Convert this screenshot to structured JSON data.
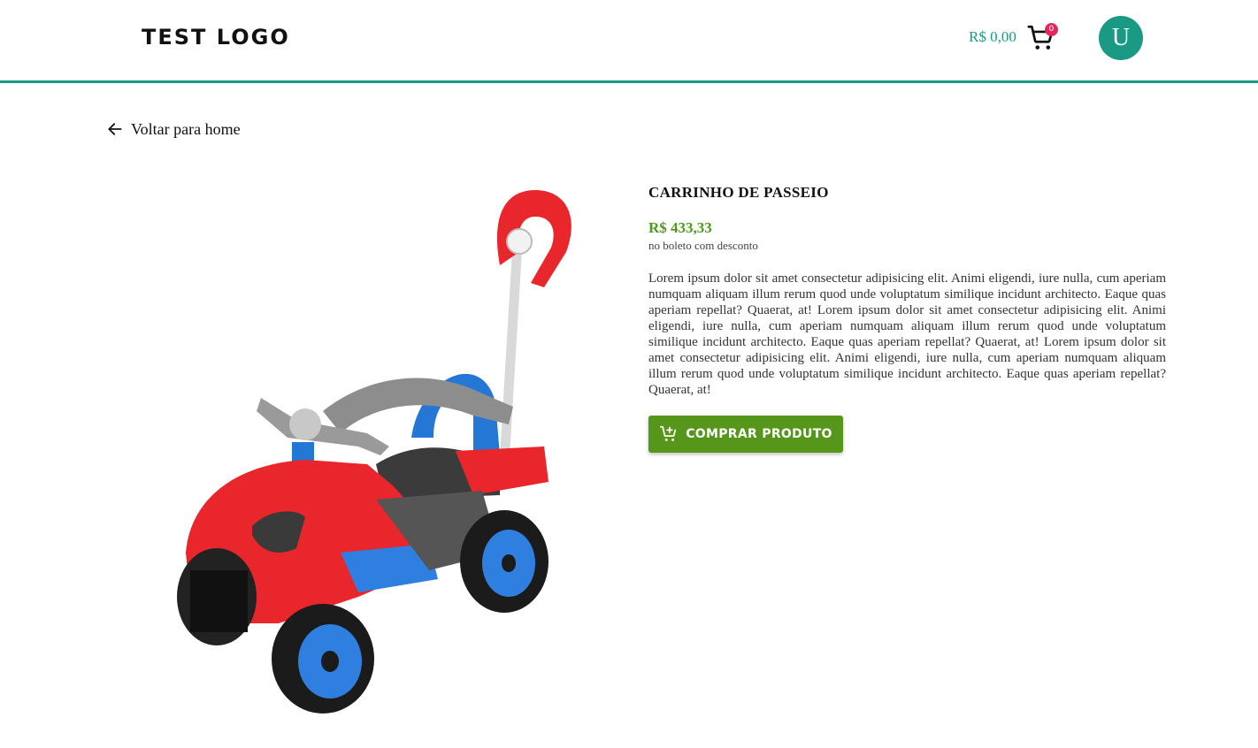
{
  "header": {
    "logo": "TEST LOGO",
    "cart_total": "R$ 0,00",
    "cart_count": "0",
    "avatar_initial": "U"
  },
  "nav": {
    "back_label": "Voltar para home"
  },
  "product": {
    "title": "CARRINHO DE PASSEIO",
    "price": "R$ 433,33",
    "price_note": "no boleto com desconto",
    "description": "Lorem ipsum dolor sit amet consectetur adipisicing elit. Animi eligendi, iure nulla, cum aperiam numquam aliquam illum rerum quod unde voluptatum similique incidunt architecto. Eaque quas aperiam repellat? Quaerat, at! Lorem ipsum dolor sit amet consectetur adipisicing elit. Animi eligendi, iure nulla, cum aperiam numquam aliquam illum rerum quod unde voluptatum similique incidunt architecto. Eaque quas aperiam repellat? Quaerat, at! Lorem ipsum dolor sit amet consectetur adipisicing elit. Animi eligendi, iure nulla, cum aperiam numquam aliquam illum rerum quod unde voluptatum similique incidunt architecto. Eaque quas aperiam repellat? Quaerat, at!",
    "buy_label": "COMPRAR PRODUTO"
  },
  "colors": {
    "accent": "#1a9a84",
    "price": "#4e9a1b",
    "buy_button": "#56961b",
    "badge": "#e8245c"
  },
  "icons": {
    "back": "arrow-left-icon",
    "cart": "shopping-cart-icon",
    "buy": "add-to-cart-icon"
  }
}
